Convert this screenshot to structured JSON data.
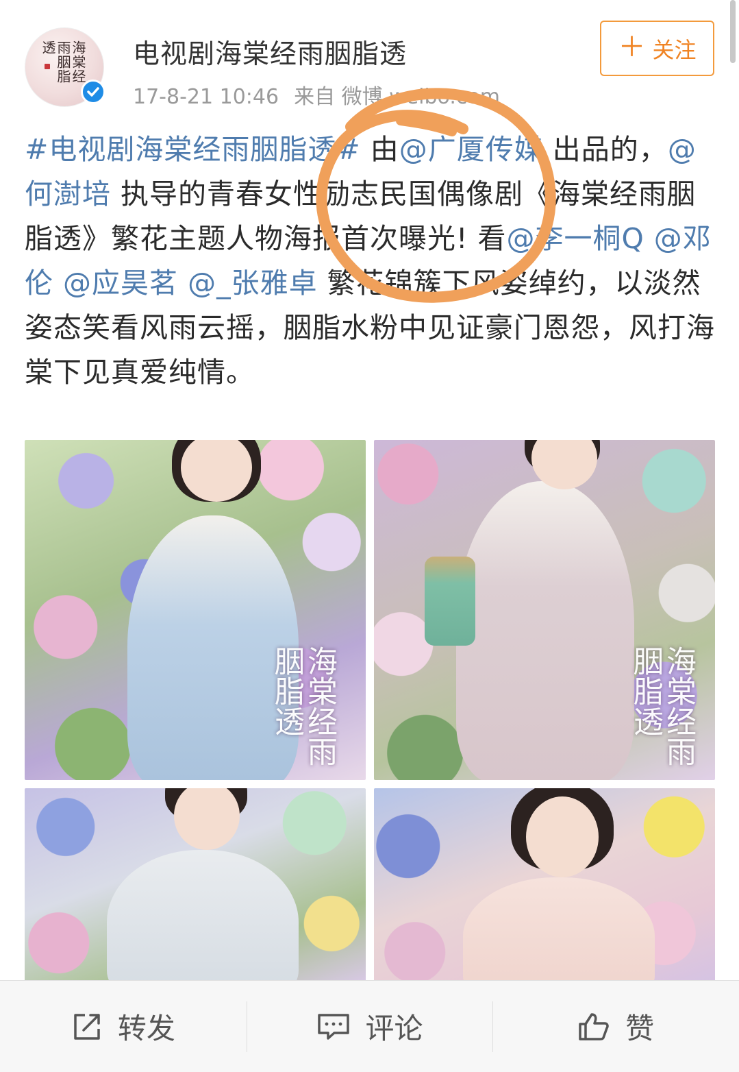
{
  "header": {
    "avatar_text": "海棠经雨胭脂透",
    "user_name": "电视剧海棠经雨胭脂透",
    "timestamp": "17-8-21 10:46",
    "source": "来自 微博 weibo.com",
    "follow_label": "关注"
  },
  "post": {
    "segments": [
      {
        "text": "#电视剧海棠经雨胭脂透#",
        "link": true
      },
      {
        "text": " 由",
        "link": false
      },
      {
        "text": "@广厦传媒",
        "link": true
      },
      {
        "text": " 出品的，",
        "link": false
      },
      {
        "text": "@何澍培",
        "link": true
      },
      {
        "text": " 执导的青春女性励志民国偶像剧《海棠经雨胭脂透》繁花主题人物海报首次曝光! 看",
        "link": false
      },
      {
        "text": "@李一桐Q",
        "link": true
      },
      {
        "text": " ",
        "link": false
      },
      {
        "text": "@邓伦",
        "link": true
      },
      {
        "text": " ",
        "link": false
      },
      {
        "text": "@应昊茗",
        "link": true
      },
      {
        "text": " ",
        "link": false
      },
      {
        "text": "@_张雅卓",
        "link": true
      },
      {
        "text": " 繁花锦簇下风姿绰约，以淡然姿态笑看风雨云摇，胭脂水粉中见证豪门恩怨，风打海棠下见真爱纯情。",
        "link": false
      }
    ]
  },
  "images": {
    "poster_title_1": "海棠经雨胭脂透",
    "poster_title_2": "海棠经雨胭脂透"
  },
  "actions": {
    "repost_label": "转发",
    "comment_label": "评论",
    "like_label": "赞"
  },
  "colors": {
    "accent": "#f08424",
    "link": "#4f7cae",
    "verified": "#1f8ce6",
    "annotation_stroke": "#f0a05a"
  }
}
